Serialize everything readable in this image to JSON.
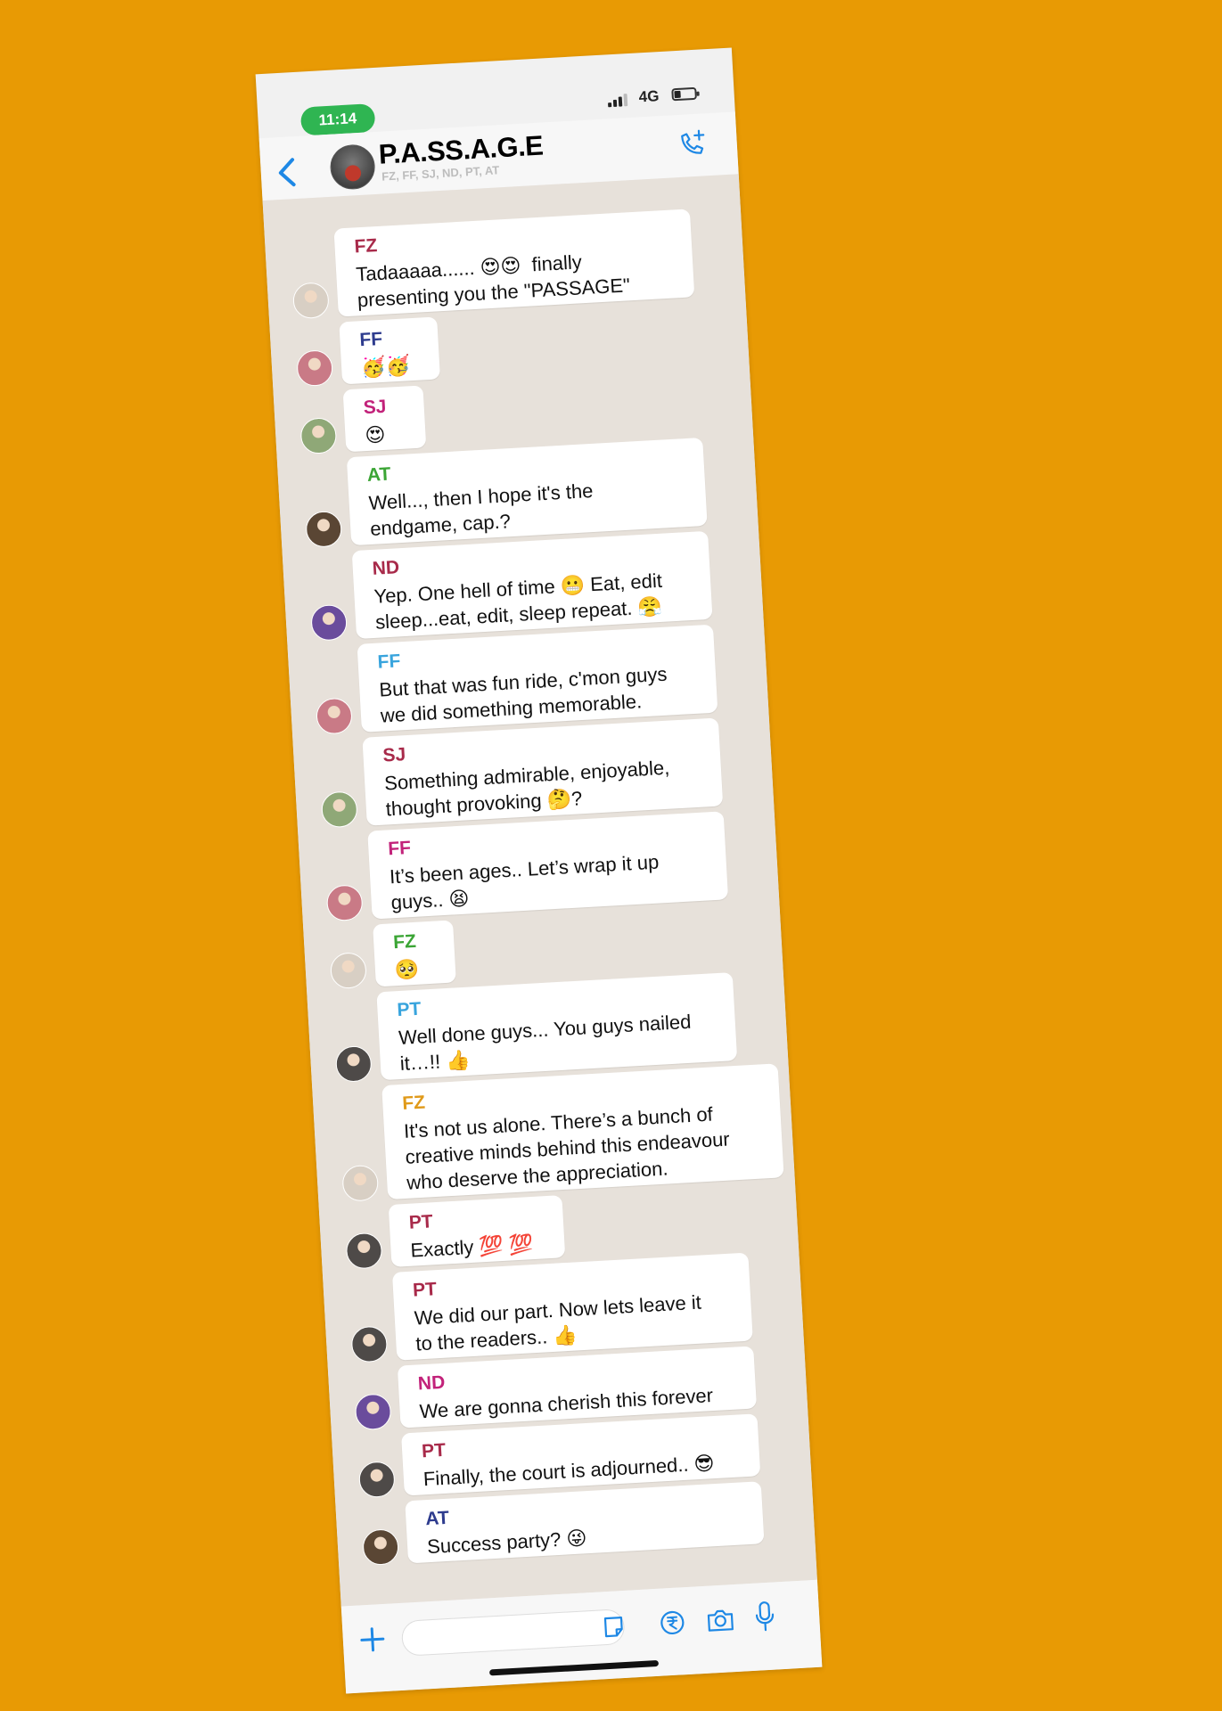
{
  "status_bar": {
    "time": "11:14",
    "network": "4G"
  },
  "header": {
    "title": "P.A.SS.A.G.E",
    "members": "FZ, FF, SJ, ND, PT, AT"
  },
  "colors": {
    "background": "#E89A04",
    "accent": "#1E88E5",
    "time_pill": "#2FB552"
  },
  "messages": [
    {
      "sender": "FZ",
      "sender_color": "#A82A4A",
      "avatar_color": "#D8CFC4",
      "lines": [
        "Tadaaaaa...... 😍😍  finally",
        "presenting you the \"PASSAGE\""
      ]
    },
    {
      "sender": "FF",
      "sender_color": "#2E3C8E",
      "avatar_color": "#C97A86",
      "lines": [
        "🥳🥳"
      ]
    },
    {
      "sender": "SJ",
      "sender_color": "#C2227A",
      "avatar_color": "#8FA877",
      "lines": [
        "😍"
      ]
    },
    {
      "sender": "AT",
      "sender_color": "#3BA535",
      "avatar_color": "#5A4634",
      "lines": [
        "Well..., then I hope it's the",
        "endgame, cap.?"
      ]
    },
    {
      "sender": "ND",
      "sender_color": "#A82A4A",
      "avatar_color": "#6A4C9C",
      "lines": [
        "Yep. One hell of time 😬 Eat, edit",
        "sleep...eat, edit, sleep repeat. 😤"
      ]
    },
    {
      "sender": "FF",
      "sender_color": "#38A4DD",
      "avatar_color": "#C97A86",
      "lines": [
        "But that was fun ride, c'mon guys",
        "we did something memorable."
      ]
    },
    {
      "sender": "SJ",
      "sender_color": "#A82A4A",
      "avatar_color": "#8FA877",
      "lines": [
        "Something admirable, enjoyable,",
        "thought provoking 🤔?"
      ]
    },
    {
      "sender": "FF",
      "sender_color": "#C2227A",
      "avatar_color": "#C97A86",
      "lines": [
        "It’s been ages.. Let’s wrap it up",
        "guys.. 😫"
      ]
    },
    {
      "sender": "FZ",
      "sender_color": "#3BA535",
      "avatar_color": "#D8CFC4",
      "lines": [
        "🥺"
      ]
    },
    {
      "sender": "PT",
      "sender_color": "#38A4DD",
      "avatar_color": "#4E4A48",
      "lines": [
        "Well done guys... You guys nailed",
        "it…!! 👍"
      ]
    },
    {
      "sender": "FZ",
      "sender_color": "#E09A1A",
      "avatar_color": "#D8CFC4",
      "lines": [
        "It's not us alone. There’s a bunch of",
        "creative minds behind this endeavour",
        "who deserve the appreciation."
      ]
    },
    {
      "sender": "PT",
      "sender_color": "#A82A4A",
      "avatar_color": "#4E4A48",
      "lines": [
        "Exactly 💯 💯"
      ]
    },
    {
      "sender": "PT",
      "sender_color": "#A82A4A",
      "avatar_color": "#4E4A48",
      "lines": [
        "We did our part. Now lets leave it",
        "to the readers.. 👍"
      ]
    },
    {
      "sender": "ND",
      "sender_color": "#C2227A",
      "avatar_color": "#6A4C9C",
      "lines": [
        "We are gonna cherish this forever"
      ]
    },
    {
      "sender": "PT",
      "sender_color": "#A82A4A",
      "avatar_color": "#4E4A48",
      "lines": [
        "Finally, the court is adjourned.. 😎"
      ]
    },
    {
      "sender": "AT",
      "sender_color": "#2E3C8E",
      "avatar_color": "#5A4634",
      "lines": [
        "Success party? 😜"
      ]
    }
  ],
  "input_bar": {
    "placeholder": ""
  }
}
